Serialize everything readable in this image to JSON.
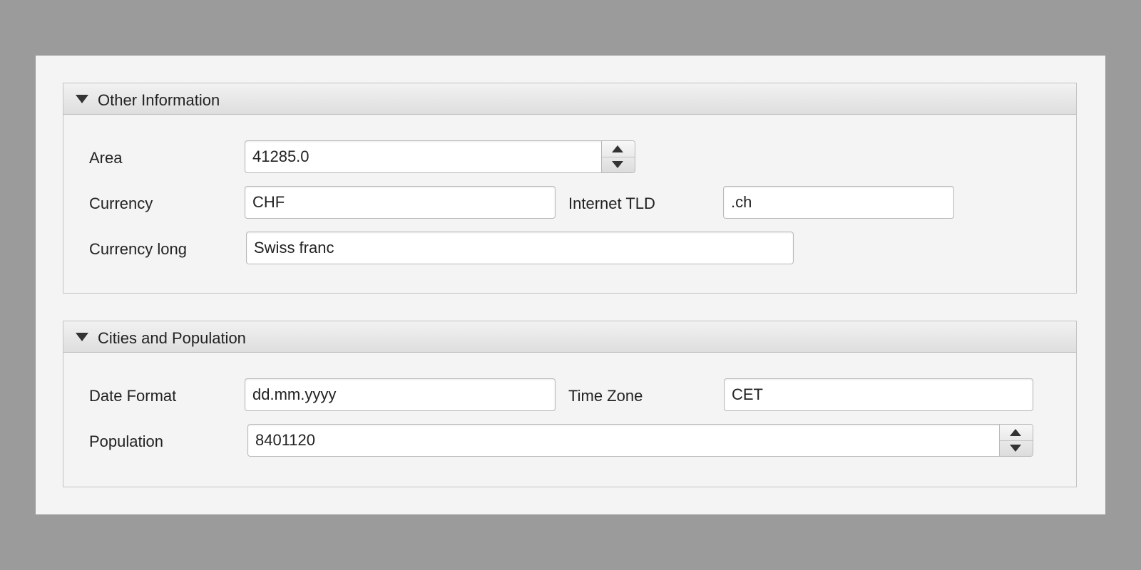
{
  "other_information": {
    "title": "Other Information",
    "area": {
      "label": "Area",
      "value": "41285.0"
    },
    "currency": {
      "label": "Currency",
      "value": "CHF"
    },
    "internet_tld": {
      "label": "Internet TLD",
      "value": ".ch"
    },
    "currency_long": {
      "label": "Currency long",
      "value": "Swiss franc"
    }
  },
  "cities_and_population": {
    "title": "Cities and Population",
    "date_format": {
      "label": "Date Format",
      "value": "dd.mm.yyyy"
    },
    "time_zone": {
      "label": "Time Zone",
      "value": "CET"
    },
    "population": {
      "label": "Population",
      "value": "8401120"
    }
  },
  "icons": {
    "pane_toggle": "triangle-down-icon",
    "spin_up": "arrow-up-icon",
    "spin_down": "arrow-down-icon"
  }
}
